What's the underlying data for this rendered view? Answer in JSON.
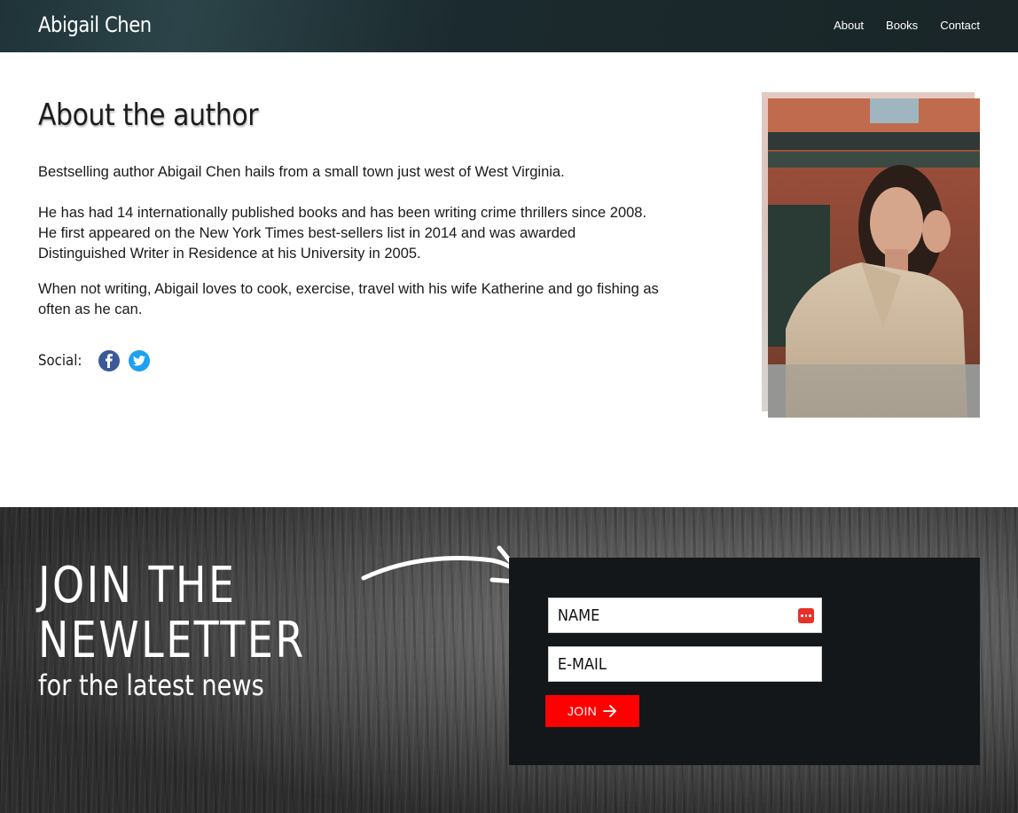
{
  "header": {
    "site_title": "Abigail Chen",
    "nav": [
      "About",
      "Books",
      "Contact"
    ]
  },
  "about": {
    "heading": "About the author",
    "paragraphs": [
      "Bestselling author Abigail Chen hails from a small town just west of West Virginia.",
      "He has had 14 internationally published books and has been writing crime thrillers since 2008. He first appeared on the New York Times best-sellers list in 2014 and was awarded Distinguished Writer in Residence at his University in 2005.",
      "When not writing, Abigail loves to cook, exercise, travel with his wife Katherine and go fishing as often as he can."
    ],
    "social_label": "Social:",
    "social_icons": [
      "facebook-icon",
      "twitter-icon"
    ]
  },
  "newsletter": {
    "title_line1": "JOIN THE",
    "title_line2": "NEWLETTER",
    "subtitle": "for the latest news",
    "name_placeholder": "NAME",
    "email_placeholder": "E-MAIL",
    "join_label": "JOIN"
  },
  "colors": {
    "header_bg": "#1f3338",
    "join_button": "#ff0000",
    "form_bg": "#131719",
    "facebook": "#3b5998",
    "twitter": "#1da1f2"
  }
}
